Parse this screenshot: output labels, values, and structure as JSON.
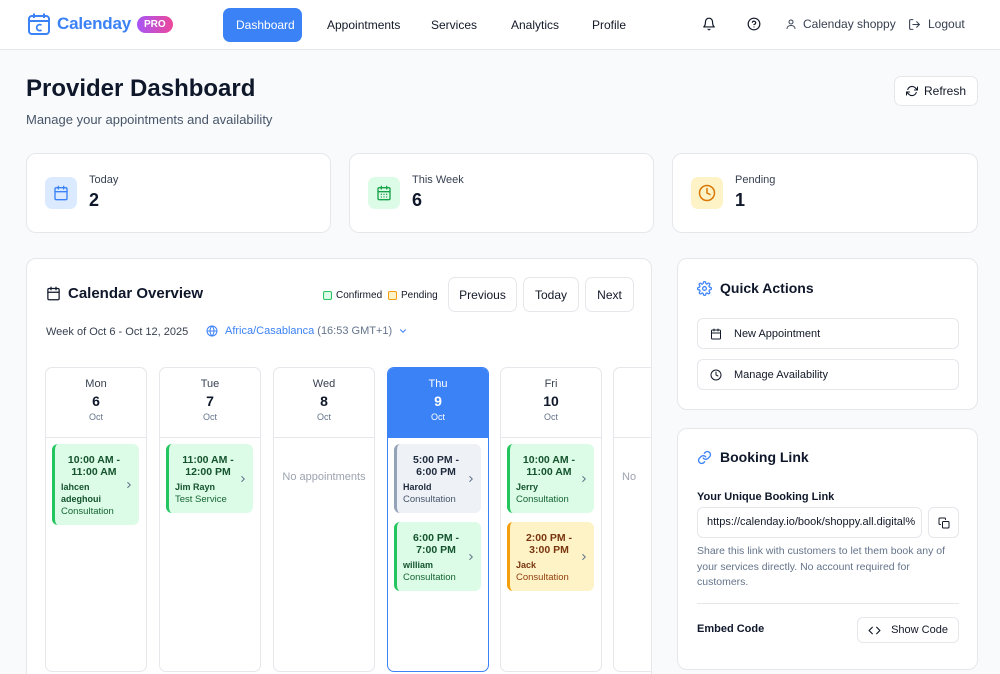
{
  "brand": {
    "name": "Calenday",
    "badge": "PRO",
    "accent": "#3b82f6"
  },
  "nav": {
    "items": [
      "Dashboard",
      "Appointments",
      "Services",
      "Analytics",
      "Profile"
    ],
    "active": "Dashboard",
    "user": "Calenday shoppy",
    "logout": "Logout"
  },
  "header": {
    "title": "Provider Dashboard",
    "subtitle": "Manage your appointments and availability",
    "refresh_label": "Refresh"
  },
  "stats": [
    {
      "label": "Today",
      "value": "2",
      "icon": "calendar-icon"
    },
    {
      "label": "This Week",
      "value": "6",
      "icon": "calendar-grid-icon"
    },
    {
      "label": "Pending",
      "value": "1",
      "icon": "clock-icon"
    }
  ],
  "calendar": {
    "title": "Calendar Overview",
    "legend": {
      "confirmed": "Confirmed",
      "pending": "Pending"
    },
    "buttons": {
      "previous": "Previous",
      "today": "Today",
      "next": "Next"
    },
    "week_label": "Week of Oct 6 - Oct 12, 2025",
    "timezone": {
      "name": "Africa/Casablanca",
      "offset": "(16:53 GMT+1)"
    },
    "no_appointments": "No appointments",
    "partial_text": "No",
    "days": [
      {
        "name": "Mon",
        "num": "6",
        "month": "Oct"
      },
      {
        "name": "Tue",
        "num": "7",
        "month": "Oct"
      },
      {
        "name": "Wed",
        "num": "8",
        "month": "Oct"
      },
      {
        "name": "Thu",
        "num": "9",
        "month": "Oct"
      },
      {
        "name": "Fri",
        "num": "10",
        "month": "Oct"
      }
    ],
    "appointments": [
      {
        "time": "10:00 AM - 11:00 AM",
        "client": "lahcen adeghoui",
        "service": "Consultation",
        "status": "confirmed"
      },
      {
        "time": "11:00 AM - 12:00 PM",
        "client": "Jim Rayn",
        "service": "Test Service",
        "status": "confirmed"
      },
      {
        "time": "5:00 PM - 6:00 PM",
        "client": "Harold",
        "service": "Consultation",
        "status": "neutral"
      },
      {
        "time": "6:00 PM - 7:00 PM",
        "client": "william",
        "service": "Consultation",
        "status": "confirmed"
      },
      {
        "time": "10:00 AM - 11:00 AM",
        "client": "Jerry",
        "service": "Consultation",
        "status": "confirmed"
      },
      {
        "time": "2:00 PM - 3:00 PM",
        "client": "Jack",
        "service": "Consultation",
        "status": "pending"
      }
    ]
  },
  "quick_actions": {
    "title": "Quick Actions",
    "items": [
      "New Appointment",
      "Manage Availability"
    ]
  },
  "booking_link": {
    "title": "Booking Link",
    "label": "Your Unique Booking Link",
    "url": "https://calenday.io/book/shoppy.all.digital%",
    "help": "Share this link with customers to let them book any of your services directly. No account required for customers.",
    "embed_label": "Embed Code",
    "show_code": "Show Code"
  },
  "colors": {
    "confirmed": "#22c55e",
    "pending": "#f59e0b",
    "primary": "#3b82f6"
  }
}
